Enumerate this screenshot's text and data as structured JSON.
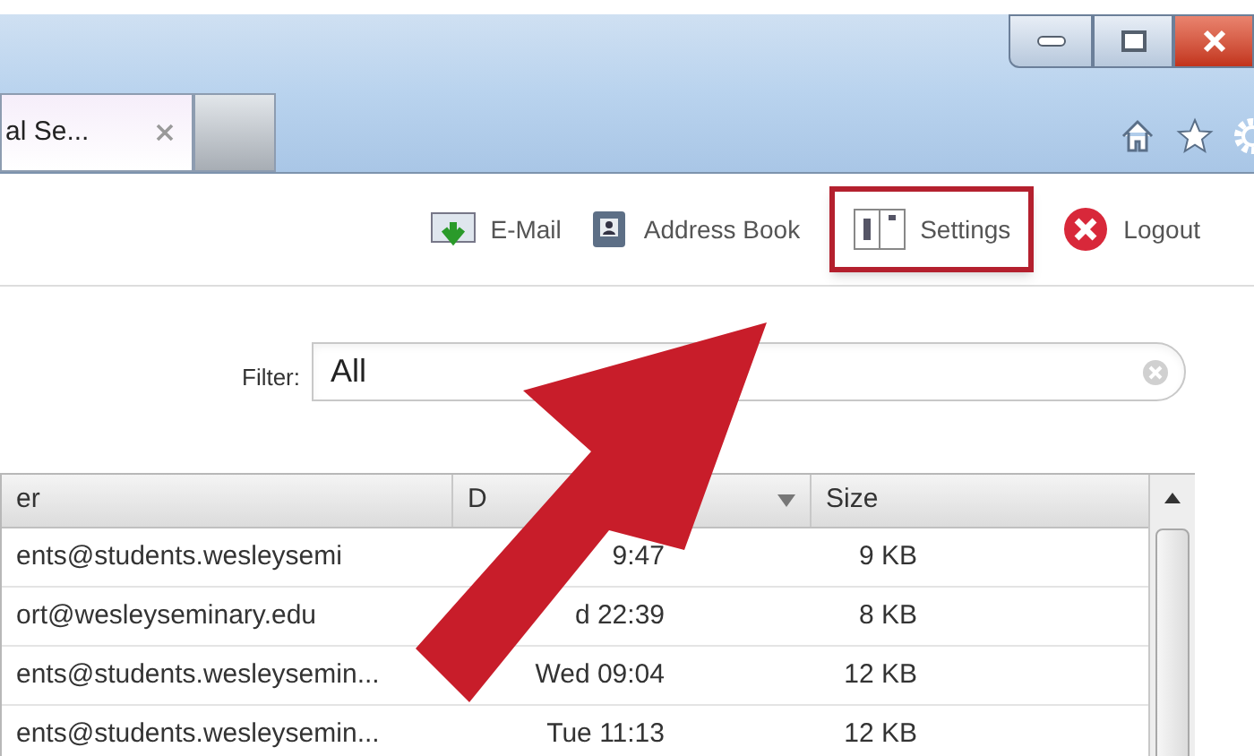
{
  "browser": {
    "tabs": [
      {
        "title": "al Se...",
        "selected": true
      },
      {
        "selected": false
      }
    ]
  },
  "toolbar": [
    {
      "kind": "email",
      "label": "E-Mail",
      "highlighted": false
    },
    {
      "kind": "addressbook",
      "label": "Address Book",
      "highlighted": false
    },
    {
      "kind": "settings",
      "label": "Settings",
      "highlighted": true
    },
    {
      "kind": "logout",
      "label": "Logout",
      "highlighted": false
    }
  ],
  "filter": {
    "label": "Filter:",
    "value": "All"
  },
  "table": {
    "columns": [
      {
        "label": "er",
        "sorted": false
      },
      {
        "label": "D",
        "sorted": true
      },
      {
        "label": "Size",
        "sorted": false
      }
    ],
    "rows": [
      {
        "sender": "ents@students.wesleysemi",
        "date": "9:47",
        "size": "9 KB"
      },
      {
        "sender": "ort@wesleyseminary.edu",
        "date": "d 22:39",
        "size": "8 KB"
      },
      {
        "sender": "ents@students.wesleysemin...",
        "date": "Wed 09:04",
        "size": "12 KB"
      },
      {
        "sender": "ents@students.wesleysemin...",
        "date": "Tue 11:13",
        "size": "12 KB"
      }
    ]
  }
}
